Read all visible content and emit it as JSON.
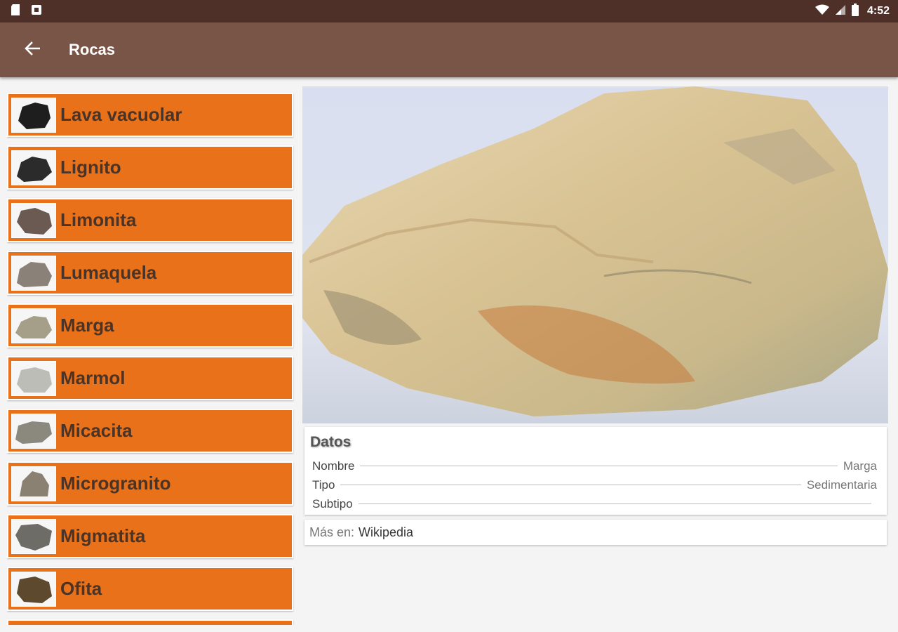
{
  "status_bar": {
    "time": "4:52"
  },
  "app_bar": {
    "title": "Rocas"
  },
  "rock_list": [
    {
      "label": "Lava vacuolar",
      "thumb_color": "#1e1e1e"
    },
    {
      "label": "Lignito",
      "thumb_color": "#2b2b2b"
    },
    {
      "label": "Limonita",
      "thumb_color": "#6b5a52"
    },
    {
      "label": "Lumaquela",
      "thumb_color": "#8a8178"
    },
    {
      "label": "Marga",
      "thumb_color": "#a59f8a"
    },
    {
      "label": "Marmol",
      "thumb_color": "#bdbdb8"
    },
    {
      "label": "Micacita",
      "thumb_color": "#8b887e"
    },
    {
      "label": "Microgranito",
      "thumb_color": "#8a8173"
    },
    {
      "label": "Migmatita",
      "thumb_color": "#6e6c66"
    },
    {
      "label": "Ofita",
      "thumb_color": "#5d4a2e"
    }
  ],
  "details": {
    "heading": "Datos",
    "rows": [
      {
        "label": "Nombre",
        "value": "Marga"
      },
      {
        "label": "Tipo",
        "value": "Sedimentaria"
      },
      {
        "label": "Subtipo",
        "value": ""
      }
    ],
    "more_label": "Más en:",
    "more_link": "Wikipedia"
  },
  "colors": {
    "status_bar": "#4e3029",
    "app_bar": "#795548",
    "list_item": "#e8711a",
    "list_text": "#4a3327"
  }
}
